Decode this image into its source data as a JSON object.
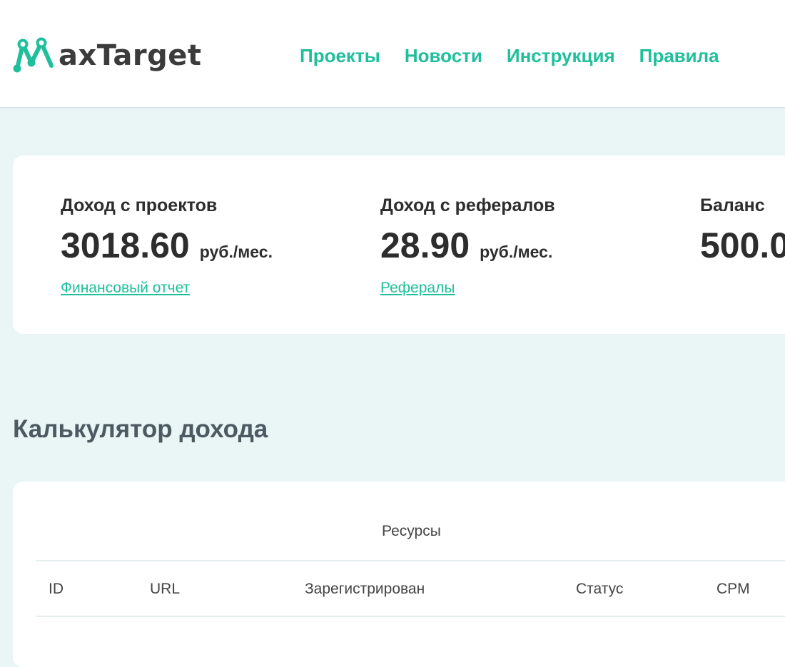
{
  "header": {
    "logo_text": "axTarget",
    "nav": [
      "Проекты",
      "Новости",
      "Инструкция",
      "Правила"
    ]
  },
  "stats": [
    {
      "label": "Доход с проектов",
      "value": "3018.60",
      "unit": "руб./мес.",
      "link": "Финансовый отчет"
    },
    {
      "label": "Доход с рефералов",
      "value": "28.90",
      "unit": "руб./мес.",
      "link": "Рефералы"
    },
    {
      "label": "Баланс",
      "value": "500.0",
      "unit": "",
      "link": ""
    }
  ],
  "calculator": {
    "title": "Калькулятор дохода",
    "table_caption": "Ресурсы",
    "columns": [
      "ID",
      "URL",
      "Зарегистрирован",
      "Статус",
      "CPM"
    ]
  },
  "colors": {
    "accent": "#1fbf9c",
    "background": "#eaf5f6",
    "text": "#2d2d2d"
  }
}
